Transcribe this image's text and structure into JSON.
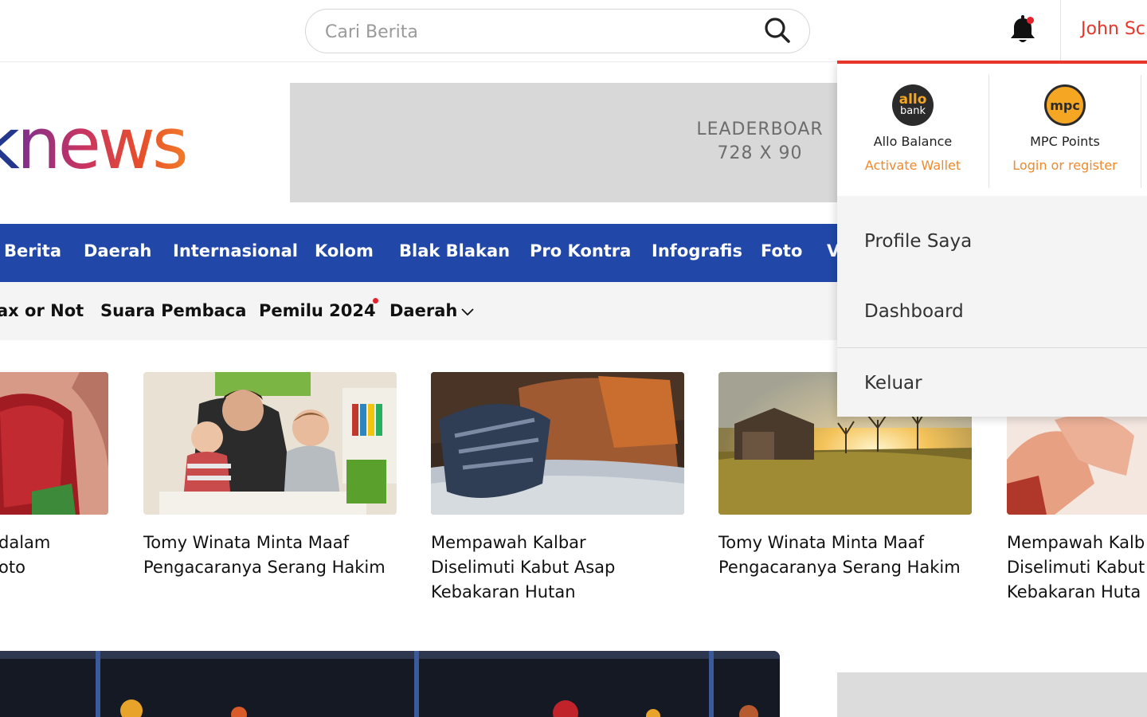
{
  "header": {
    "search_placeholder": "Cari Berita",
    "user_name": "John Sc",
    "icons": {
      "search": "search-icon",
      "notification": "bell-icon"
    }
  },
  "logo": {
    "first": "k",
    "rest": "news"
  },
  "ad": {
    "line1": "LEADERBOAR",
    "line2": "728 X 90"
  },
  "nav": {
    "items": [
      "Berita",
      "Daerah",
      "Internasional",
      "Kolom",
      "Blak Blakan",
      "Pro Kontra",
      "Infografis",
      "Foto",
      "V"
    ]
  },
  "subnav": {
    "items": [
      "ax or Not",
      "Suara Pembaca",
      "Pemilu 2024",
      "Daerah"
    ]
  },
  "cards": [
    {
      "title_line1": "dalam",
      "title_line2": "oto",
      "title_line3": ""
    },
    {
      "title_line1": "Tomy Winata Minta Maaf",
      "title_line2": "Pengacaranya Serang Hakim",
      "title_line3": ""
    },
    {
      "title_line1": "Mempawah Kalbar",
      "title_line2": "Diselimuti Kabut Asap",
      "title_line3": "Kebakaran Hutan"
    },
    {
      "title_line1": "Tomy Winata Minta Maaf",
      "title_line2": "Pengacaranya Serang Hakim",
      "title_line3": ""
    },
    {
      "title_line1": "Mempawah Kalb",
      "title_line2": "Diselimuti Kabut",
      "title_line3": "Kebakaran Huta"
    }
  ],
  "dropdown": {
    "allo": {
      "logo_top": "allo",
      "logo_bottom": "bank",
      "title": "Allo Balance",
      "link": "Activate Wallet"
    },
    "mpc": {
      "logo": "mpc",
      "title": "MPC Points",
      "link": "Login or register"
    },
    "menu": [
      "Profile Saya",
      "Dashboard",
      "Keluar"
    ]
  },
  "colors": {
    "brand_blue": "#2148a8",
    "accent_red": "#e8362a",
    "accent_orange": "#f0892a"
  }
}
